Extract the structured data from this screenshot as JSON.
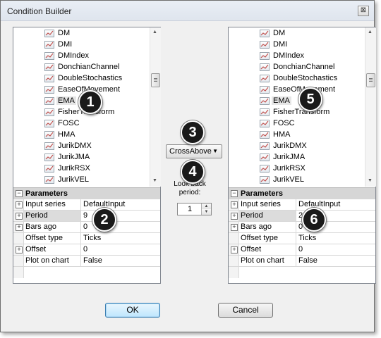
{
  "window": {
    "title": "Condition Builder",
    "close_glyph": "⊠"
  },
  "left": {
    "items": [
      "DM",
      "DMI",
      "DMIndex",
      "DonchianChannel",
      "DoubleStochastics",
      "EaseOfMovement",
      "EMA",
      "FisherTransform",
      "FOSC",
      "HMA",
      "JurikDMX",
      "JurikJMA",
      "JurikRSX",
      "JurikVEL"
    ],
    "selected": "EMA",
    "params_header": "Parameters",
    "params": [
      {
        "key": "Input series",
        "value": "DefaultInput",
        "expand": "+"
      },
      {
        "key": "Period",
        "value": "9",
        "expand": "+"
      },
      {
        "key": "Bars ago",
        "value": "0",
        "expand": "+"
      },
      {
        "key": "Offset type",
        "value": "Ticks",
        "expand": ""
      },
      {
        "key": "Offset",
        "value": "0",
        "expand": "+"
      },
      {
        "key": "Plot on chart",
        "value": "False",
        "expand": ""
      }
    ]
  },
  "right": {
    "items": [
      "DM",
      "DMI",
      "DMIndex",
      "DonchianChannel",
      "DoubleStochastics",
      "EaseOfMovement",
      "EMA",
      "FisherTransform",
      "FOSC",
      "HMA",
      "JurikDMX",
      "JurikJMA",
      "JurikRSX",
      "JurikVEL"
    ],
    "selected": "EMA",
    "params_header": "Parameters",
    "params": [
      {
        "key": "Input series",
        "value": "DefaultInput",
        "expand": "+"
      },
      {
        "key": "Period",
        "value": "20",
        "expand": "+"
      },
      {
        "key": "Bars ago",
        "value": "0",
        "expand": "+"
      },
      {
        "key": "Offset type",
        "value": "Ticks",
        "expand": ""
      },
      {
        "key": "Offset",
        "value": "0",
        "expand": "+"
      },
      {
        "key": "Plot on chart",
        "value": "False",
        "expand": ""
      }
    ]
  },
  "operator": {
    "value": "CrossAbove"
  },
  "lookback": {
    "label": "Look back\nperiod:",
    "value": "1"
  },
  "badges": [
    "1",
    "2",
    "3",
    "4",
    "5",
    "6"
  ],
  "buttons": {
    "ok": "OK",
    "cancel": "Cancel"
  },
  "icons": {
    "list_item": "chart-line-icon",
    "collapse": "minus-box-icon",
    "expand": "plus-box-icon",
    "dropdown": "chevron-down-icon"
  }
}
